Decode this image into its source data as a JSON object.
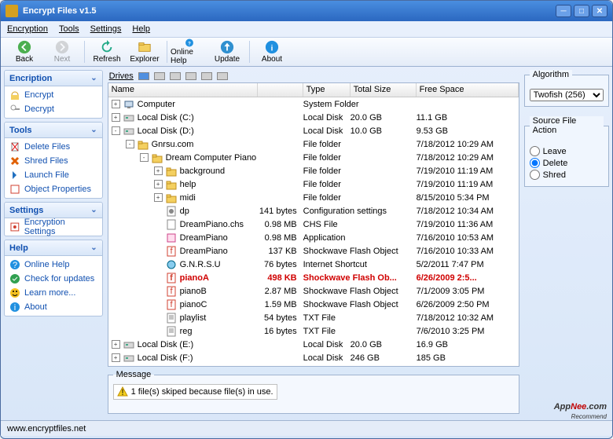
{
  "window": {
    "title": "Encrypt Files v1.5"
  },
  "menu": {
    "encryption": "Encryption",
    "tools": "Tools",
    "settings": "Settings",
    "help": "Help"
  },
  "toolbar": {
    "back": "Back",
    "next": "Next",
    "refresh": "Refresh",
    "explorer": "Explorer",
    "onlinehelp": "Online Help",
    "update": "Update",
    "about": "About"
  },
  "sidebar": {
    "encryption": {
      "title": "Encription",
      "encrypt": "Encrypt",
      "decrypt": "Decrypt"
    },
    "tools": {
      "title": "Tools",
      "delete": "Delete Files",
      "shred": "Shred Files",
      "launch": "Launch File",
      "props": "Object Properties"
    },
    "settings": {
      "title": "Settings",
      "encset": "Encryption Settings"
    },
    "help": {
      "title": "Help",
      "online": "Online Help",
      "check": "Check for updates",
      "learn": "Learn more...",
      "about": "About"
    }
  },
  "drives": {
    "label": "Drives"
  },
  "columns": {
    "name": "Name",
    "type": "Type",
    "totalsize": "Total Size",
    "freespace": "Free Space"
  },
  "rows": [
    {
      "indent": 0,
      "exp": "+",
      "ico": "computer",
      "name": "Computer",
      "size": "",
      "type": "System Folder",
      "date": ""
    },
    {
      "indent": 0,
      "exp": "+",
      "ico": "disk",
      "name": "Local Disk (C:)",
      "size": "",
      "type": "Local Disk",
      "totalsize": "20.0 GB",
      "free": "11.1 GB"
    },
    {
      "indent": 0,
      "exp": "-",
      "ico": "disk",
      "name": "Local Disk (D:)",
      "size": "",
      "type": "Local Disk",
      "totalsize": "10.0 GB",
      "free": "9.53 GB"
    },
    {
      "indent": 1,
      "exp": "-",
      "ico": "folder",
      "name": "Gnrsu.com",
      "size": "",
      "type": "File folder",
      "date": "7/18/2012 10:29 AM"
    },
    {
      "indent": 2,
      "exp": "-",
      "ico": "folder",
      "name": "Dream Computer Piano",
      "size": "",
      "type": "File folder",
      "date": "7/18/2012 10:29 AM"
    },
    {
      "indent": 3,
      "exp": "+",
      "ico": "folder",
      "name": "background",
      "size": "",
      "type": "File folder",
      "date": "7/19/2010 11:19 AM"
    },
    {
      "indent": 3,
      "exp": "+",
      "ico": "folder",
      "name": "help",
      "size": "",
      "type": "File folder",
      "date": "7/19/2010 11:19 AM"
    },
    {
      "indent": 3,
      "exp": "+",
      "ico": "folder",
      "name": "midi",
      "size": "",
      "type": "File folder",
      "date": "8/15/2010 5:34 PM"
    },
    {
      "indent": 3,
      "exp": "",
      "ico": "cfg",
      "name": "dp",
      "size": "141 bytes",
      "type": "Configuration settings",
      "date": "7/18/2012 10:34 AM"
    },
    {
      "indent": 3,
      "exp": "",
      "ico": "file",
      "name": "DreamPiano.chs",
      "size": "0.98 MB",
      "type": "CHS File",
      "date": "7/19/2010 11:36 AM"
    },
    {
      "indent": 3,
      "exp": "",
      "ico": "app",
      "name": "DreamPiano",
      "size": "0.98 MB",
      "type": "Application",
      "date": "7/16/2010 10:53 AM"
    },
    {
      "indent": 3,
      "exp": "",
      "ico": "swf",
      "name": "DreamPiano",
      "size": "137 KB",
      "type": "Shockwave Flash Object",
      "date": "7/16/2010 10:33 AM"
    },
    {
      "indent": 3,
      "exp": "",
      "ico": "url",
      "name": "G.N.R.S.U",
      "size": "76 bytes",
      "type": "Internet Shortcut",
      "date": "5/2/2011 7:47 PM"
    },
    {
      "indent": 3,
      "exp": "",
      "ico": "swf",
      "name": "pianoA",
      "size": "498 KB",
      "type": "Shockwave Flash Ob...",
      "date": "6/26/2009 2:5...",
      "hl": true
    },
    {
      "indent": 3,
      "exp": "",
      "ico": "swf",
      "name": "pianoB",
      "size": "2.87 MB",
      "type": "Shockwave Flash Object",
      "date": "7/1/2009 3:05 PM"
    },
    {
      "indent": 3,
      "exp": "",
      "ico": "swf",
      "name": "pianoC",
      "size": "1.59 MB",
      "type": "Shockwave Flash Object",
      "date": "6/26/2009 2:50 PM"
    },
    {
      "indent": 3,
      "exp": "",
      "ico": "txt",
      "name": "playlist",
      "size": "54 bytes",
      "type": "TXT File",
      "date": "7/18/2012 10:32 AM"
    },
    {
      "indent": 3,
      "exp": "",
      "ico": "txt",
      "name": "reg",
      "size": "16 bytes",
      "type": "TXT File",
      "date": "7/6/2010 3:25 PM"
    },
    {
      "indent": 0,
      "exp": "+",
      "ico": "disk",
      "name": "Local Disk (E:)",
      "size": "",
      "type": "Local Disk",
      "totalsize": "20.0 GB",
      "free": "16.9 GB"
    },
    {
      "indent": 0,
      "exp": "+",
      "ico": "disk",
      "name": "Local Disk (F:)",
      "size": "",
      "type": "Local Disk",
      "totalsize": "246 GB",
      "free": "185 GB"
    }
  ],
  "message": {
    "label": "Message",
    "text": "1 file(s) skiped because file(s) in use."
  },
  "right": {
    "algo": {
      "label": "Algorithm",
      "value": "Twofish (256)"
    },
    "action": {
      "label": "Source File Action",
      "leave": "Leave",
      "delete": "Delete",
      "shred": "Shred",
      "selected": "Delete"
    }
  },
  "status": {
    "url": "www.encryptfiles.net"
  },
  "watermark": {
    "a": "App",
    "b": "Nee",
    "c": ".com",
    "rec": "Recommend"
  }
}
